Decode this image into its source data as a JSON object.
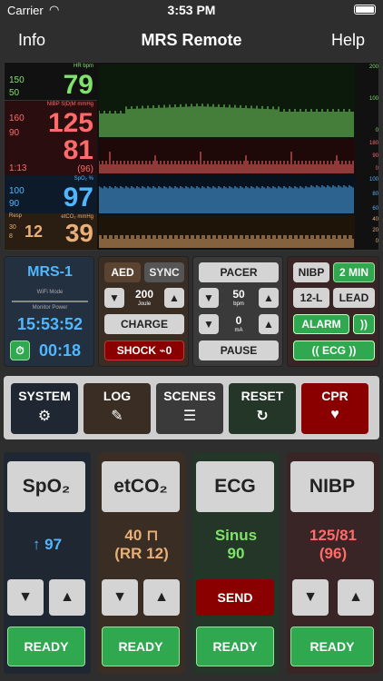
{
  "status": {
    "carrier": "Carrier",
    "time": "3:53 PM"
  },
  "nav": {
    "left": "Info",
    "title": "MRS Remote",
    "right": "Help"
  },
  "monitor": {
    "hr": {
      "label": "HR bpm",
      "hi": "150",
      "lo": "50",
      "value": "79",
      "color": "#7fe36a"
    },
    "nibp": {
      "label": "NIBP S|D|M mmHg",
      "hi": "160",
      "lo": "90",
      "sys": "125",
      "dia": "81",
      "mean": "(96)",
      "time": "1:13",
      "color": "#ff6a6a"
    },
    "spo2": {
      "label": "SpO₂ %",
      "hi": "100",
      "lo": "90",
      "value": "97",
      "color": "#4fb7ff"
    },
    "resp": {
      "label": "Resp",
      "label2": "etCO₂ mmHg",
      "hi": "30",
      "lo": "8",
      "rr": "12",
      "value": "39",
      "color": "#e8b078"
    },
    "scales": {
      "hr": [
        "200",
        "100",
        "0"
      ],
      "nibp": [
        "180",
        "90",
        "0"
      ],
      "spo2": [
        "100",
        "80",
        "60"
      ],
      "co2": [
        "40",
        "20",
        "0"
      ]
    }
  },
  "device": {
    "name": "MRS-1",
    "wifi": "WiFi Mode",
    "power": "Monitor Power",
    "clock": "15:53:52",
    "timer": "00:18"
  },
  "defib": {
    "aed": "AED",
    "sync": "SYNC",
    "energy": "200",
    "energy_unit": "Joule",
    "charge": "CHARGE",
    "shock": "SHOCK ⌁0"
  },
  "pacer": {
    "label": "PACER",
    "rate": "50",
    "rate_unit": "bpm",
    "current": "0",
    "current_unit": "mA",
    "pause": "PAUSE"
  },
  "nibpctl": {
    "nibp": "NIBP",
    "interval": "2 MIN",
    "lead12": "12-L",
    "lead": "LEAD",
    "alarm": "ALARM",
    "ecg": "ECG"
  },
  "actions": [
    {
      "label": "SYSTEM",
      "bg": "#1f2732",
      "icon": "⚙"
    },
    {
      "label": "LOG",
      "bg": "#3a2e24",
      "icon": "✎"
    },
    {
      "label": "SCENES",
      "bg": "#3a3a3a",
      "icon": "☰"
    },
    {
      "label": "RESET",
      "bg": "#233628",
      "icon": "↻"
    },
    {
      "label": "CPR",
      "bg": "#8a0000",
      "icon": "♥"
    }
  ],
  "cards": {
    "spo2": {
      "title": "SpO₂",
      "line1": "↑ 97",
      "line2": "",
      "color": "#4fb7ff",
      "bg": "#1f2732",
      "ready": "READY"
    },
    "etco2": {
      "title": "etCO₂",
      "line1": "40 ⊓",
      "line2": "(RR 12)",
      "color": "#e8b078",
      "bg": "#3a2e24",
      "ready": "READY"
    },
    "ecg": {
      "title": "ECG",
      "line1": "Sinus",
      "line2": "90",
      "color": "#7fe36a",
      "bg": "#233628",
      "send": "SEND",
      "ready": "READY"
    },
    "nibp": {
      "title": "NIBP",
      "line1": "125/81",
      "line2": "(96)",
      "color": "#ff6a6a",
      "bg": "#3a2526",
      "ready": "READY"
    }
  },
  "arrows": {
    "down": "▼",
    "up": "▲"
  }
}
